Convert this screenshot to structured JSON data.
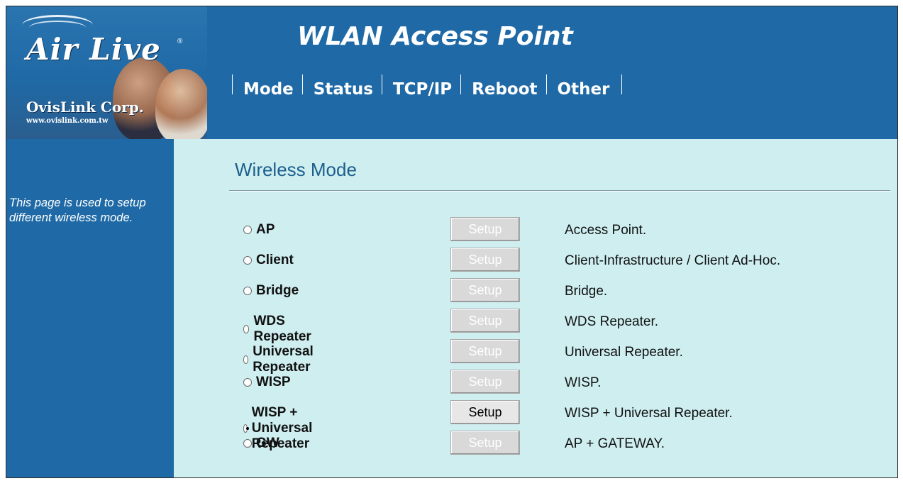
{
  "header": {
    "logo_text": "Air Live",
    "logo_reg": "®",
    "corp_name": "OvisLink Corp.",
    "corp_url": "www.ovislink.com.tw",
    "title": "WLAN Access Point",
    "tabs": [
      {
        "label": "Mode"
      },
      {
        "label": "Status"
      },
      {
        "label": "TCP/IP"
      },
      {
        "label": "Reboot"
      },
      {
        "label": "Other"
      }
    ]
  },
  "sidebar": {
    "help_text": "This page is used to setup different wireless mode."
  },
  "main": {
    "title": "Wireless Mode",
    "modes": [
      {
        "label": "AP",
        "button": "Setup",
        "description": "Access Point.",
        "selected": false,
        "enabled": false
      },
      {
        "label": "Client",
        "button": "Setup",
        "description": "Client-Infrastructure / Client Ad-Hoc.",
        "selected": false,
        "enabled": false
      },
      {
        "label": "Bridge",
        "button": "Setup",
        "description": "Bridge.",
        "selected": false,
        "enabled": false
      },
      {
        "label": "WDS Repeater",
        "button": "Setup",
        "description": "WDS Repeater.",
        "selected": false,
        "enabled": false
      },
      {
        "label": "Universal Repeater",
        "button": "Setup",
        "description": "Universal Repeater.",
        "selected": false,
        "enabled": false
      },
      {
        "label": "WISP",
        "button": "Setup",
        "description": "WISP.",
        "selected": false,
        "enabled": false
      },
      {
        "label": "WISP + Universal Repeater",
        "button": "Setup",
        "description": "WISP + Universal Repeater.",
        "selected": true,
        "enabled": true
      },
      {
        "label": "GW",
        "button": "Setup",
        "description": "AP + GATEWAY.",
        "selected": false,
        "enabled": false
      }
    ]
  },
  "colors": {
    "header_blue": "#1f6aa6",
    "content_bg": "#cfeef0",
    "title_text": "#1d5f8d"
  }
}
